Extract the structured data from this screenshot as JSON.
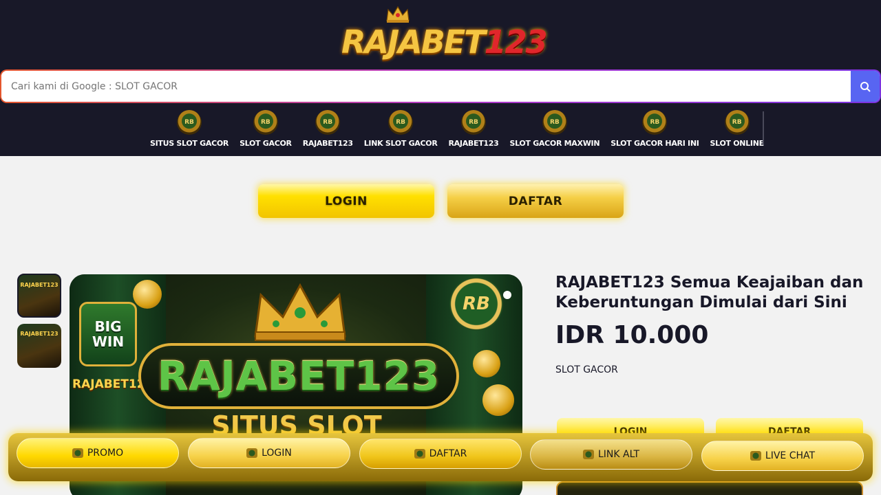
{
  "header": {
    "logo_text_a": "RAJABET",
    "logo_text_b": "123"
  },
  "search": {
    "placeholder": "Cari kami di Google : SLOT GACOR",
    "icon": "search-icon"
  },
  "nav": {
    "badge": "RB",
    "items": [
      {
        "label": "SITUS SLOT GACOR"
      },
      {
        "label": "SLOT GACOR"
      },
      {
        "label": "RAJABET123"
      },
      {
        "label": "LINK SLOT GACOR"
      },
      {
        "label": "RAJABET123"
      },
      {
        "label": "SLOT GACOR MAXWIN"
      },
      {
        "label": "SLOT GACOR HARI INI"
      },
      {
        "label": "SLOT ONLINE"
      }
    ]
  },
  "auth": {
    "login_label": "LOGIN",
    "daftar_label": "DAFTAR"
  },
  "gallery": {
    "thumb_text": "RAJABET123",
    "hero": {
      "bigwin": "BIG WIN",
      "title": "RAJABET123",
      "side": "RAJABET123",
      "sub": "SITUS SLOT",
      "badge": "RB"
    }
  },
  "product": {
    "title": "RAJABET123 Semua Keajaiban dan Keberuntungan Dimulai dari Sini",
    "price": "IDR 10.000",
    "tag": "SLOT GACOR",
    "login_label": "LOGIN",
    "daftar_label": "DAFTAR"
  },
  "bottom_bar": {
    "promo": "PROMO",
    "login": "LOGIN",
    "daftar": "DAFTAR",
    "link_alt": "LINK ALT",
    "live_chat": "LIVE CHAT"
  },
  "colors": {
    "header_bg": "#181828",
    "page_bg": "#f2f2f2",
    "gold": "#ffd800",
    "search_button": "#5865f2"
  }
}
